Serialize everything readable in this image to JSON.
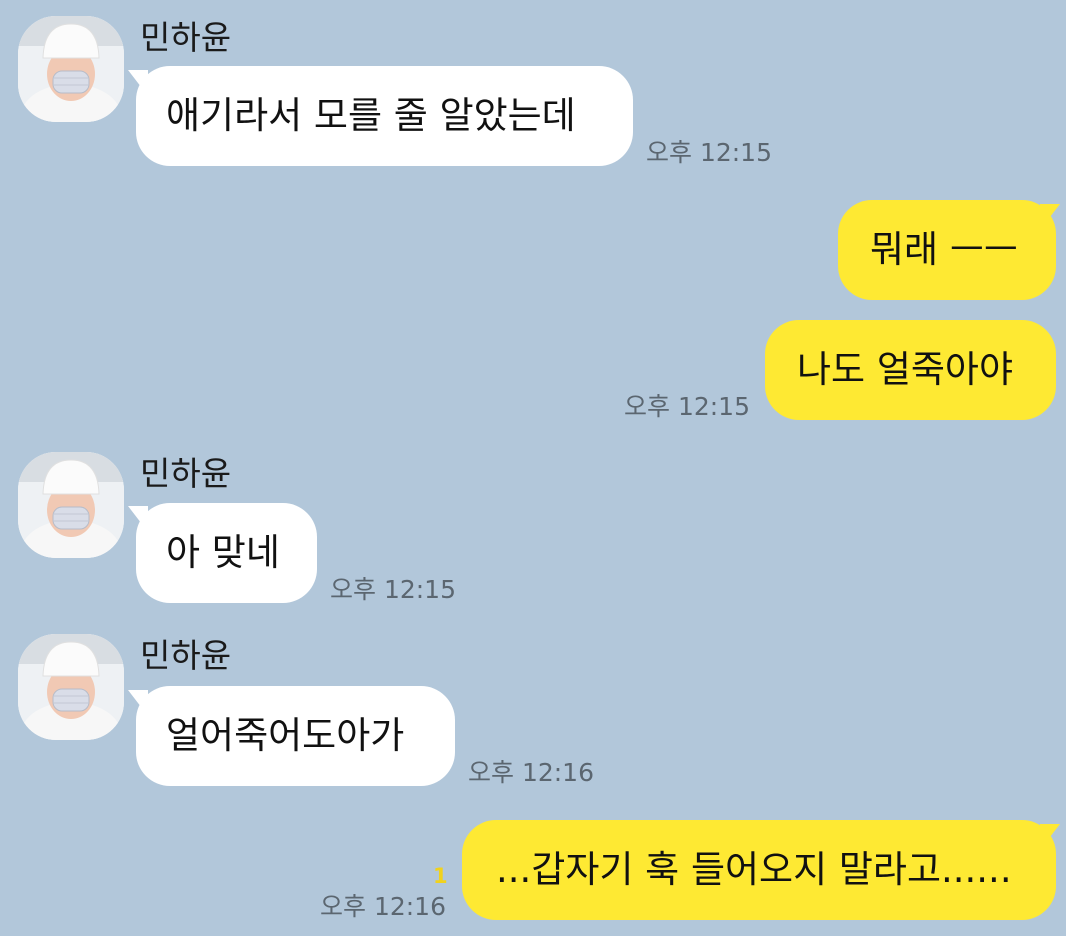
{
  "messages": [
    {
      "sender": "민하윤",
      "text": "애기라서 모를 줄 알았는데",
      "time": "오후 12:15"
    },
    {
      "text": "뭐래 ㅡㅡ"
    },
    {
      "text": "나도 얼죽아야",
      "time": "오후 12:15"
    },
    {
      "sender": "민하윤",
      "text": "아 맞네",
      "time": "오후 12:15"
    },
    {
      "sender": "민하윤",
      "text": "얼어죽어도아가",
      "time": "오후 12:16"
    },
    {
      "text": "...갑자기 훅 들어오지 말라고......",
      "time": "오후 12:16",
      "unread": "1"
    }
  ],
  "colors": {
    "background": "#b2c7da",
    "incoming_bubble": "#ffffff",
    "outgoing_bubble": "#fee933",
    "unread_count": "#f1d21c"
  },
  "icons": {
    "avatar": "profile-avatar-white-beanie-mask"
  }
}
